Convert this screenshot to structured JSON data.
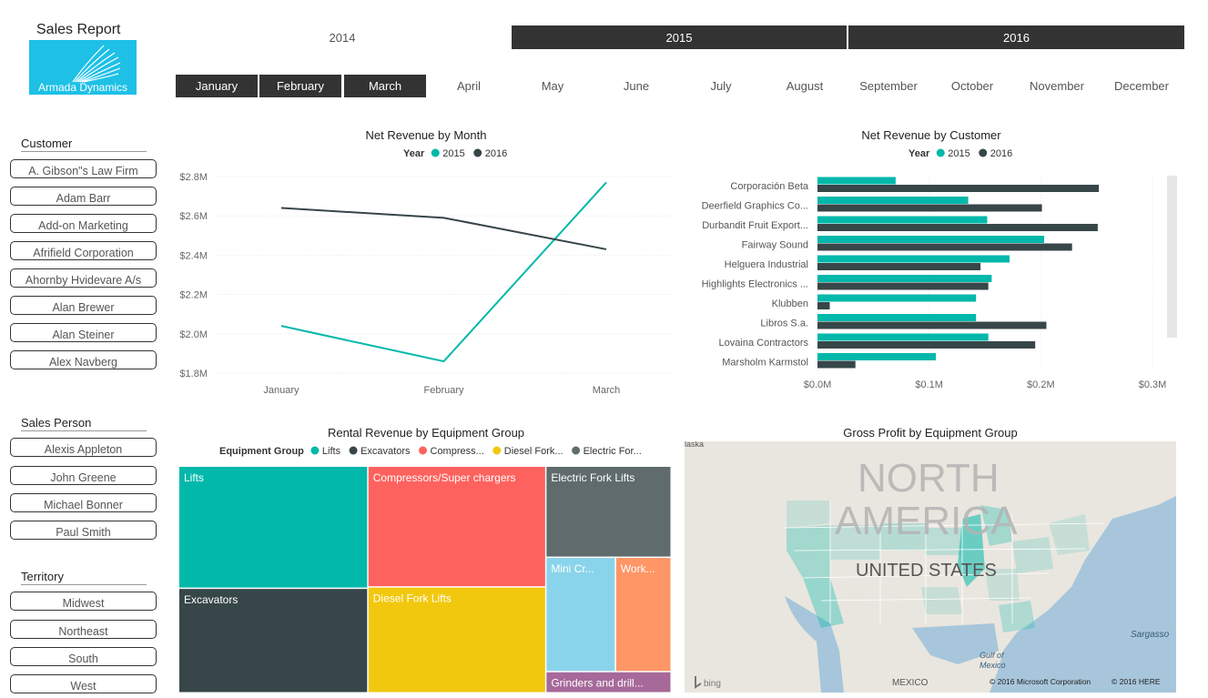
{
  "header": {
    "title": "Sales Report",
    "logo_text": "Armada Dynamics"
  },
  "years": [
    {
      "label": "2014",
      "selected": false
    },
    {
      "label": "2015",
      "selected": true
    },
    {
      "label": "2016",
      "selected": true
    }
  ],
  "months": [
    {
      "label": "January",
      "selected": true
    },
    {
      "label": "February",
      "selected": true
    },
    {
      "label": "March",
      "selected": true
    },
    {
      "label": "April",
      "selected": false
    },
    {
      "label": "May",
      "selected": false
    },
    {
      "label": "June",
      "selected": false
    },
    {
      "label": "July",
      "selected": false
    },
    {
      "label": "August",
      "selected": false
    },
    {
      "label": "September",
      "selected": false
    },
    {
      "label": "October",
      "selected": false
    },
    {
      "label": "November",
      "selected": false
    },
    {
      "label": "December",
      "selected": false
    }
  ],
  "slicers": {
    "customer": {
      "title": "Customer",
      "items": [
        "A. Gibson\"s Law Firm",
        "Adam Barr",
        "Add-on Marketing",
        "Afrifield Corporation",
        "Ahornby Hvidevare A/s",
        "Alan Brewer",
        "Alan Steiner",
        "Alex Navberg"
      ]
    },
    "sales_person": {
      "title": "Sales Person",
      "items": [
        "Alexis Appleton",
        "John Greene",
        "Michael Bonner",
        "Paul Smith"
      ]
    },
    "territory": {
      "title": "Territory",
      "items": [
        "Midwest",
        "Northeast",
        "South",
        "West"
      ]
    }
  },
  "colors": {
    "series_2015": "#01b8aa",
    "series_2016": "#374649",
    "selected": "#333333",
    "logo_bg": "#1ec0e6"
  },
  "chart_data": [
    {
      "type": "line",
      "title": "Net Revenue by Month",
      "legend_title": "Year",
      "legend_position": "top-center",
      "categories": [
        "January",
        "February",
        "March"
      ],
      "y_ticks": [
        "$1.8M",
        "$2.0M",
        "$2.2M",
        "$2.4M",
        "$2.6M",
        "$2.8M"
      ],
      "ylim": [
        1.8,
        2.8
      ],
      "grid": true,
      "series": [
        {
          "name": "2015",
          "color": "#01b8aa",
          "values": [
            2.04,
            1.86,
            2.77
          ]
        },
        {
          "name": "2016",
          "color": "#374649",
          "values": [
            2.64,
            2.59,
            2.43
          ]
        }
      ]
    },
    {
      "type": "bar",
      "orientation": "horizontal",
      "title": "Net Revenue by Customer",
      "legend_title": "Year",
      "legend_position": "top-center",
      "categories": [
        "Corporación Beta",
        "Deerfield Graphics Co...",
        "Durbandit Fruit Export...",
        "Fairway Sound",
        "Helguera Industrial",
        "Highlights Electronics ...",
        "Klubben",
        "Libros S.a.",
        "Lovaina Contractors",
        "Marsholm Karmstol"
      ],
      "x_ticks": [
        "$0.0M",
        "$0.1M",
        "$0.2M",
        "$0.3M"
      ],
      "xlim": [
        0,
        0.3
      ],
      "grid": true,
      "series": [
        {
          "name": "2015",
          "color": "#01b8aa",
          "values": [
            0.07,
            0.135,
            0.152,
            0.203,
            0.172,
            0.156,
            0.142,
            0.142,
            0.153,
            0.106
          ]
        },
        {
          "name": "2016",
          "color": "#374649",
          "values": [
            0.252,
            0.201,
            0.251,
            0.228,
            0.146,
            0.153,
            0.011,
            0.205,
            0.195,
            0.034
          ]
        }
      ]
    },
    {
      "type": "treemap",
      "title": "Rental Revenue by Equipment Group",
      "legend_title": "Equipment Group",
      "legend_position": "top-left",
      "legend": [
        {
          "name": "Lifts",
          "color": "#01b8aa"
        },
        {
          "name": "Excavators",
          "color": "#374649"
        },
        {
          "name": "Compress...",
          "color": "#fd625e"
        },
        {
          "name": "Diesel Fork...",
          "color": "#f2c80f"
        },
        {
          "name": "Electric For...",
          "color": "#5f6b6d"
        }
      ],
      "tiles": [
        {
          "label": "Lifts",
          "color": "#01b8aa",
          "value": 17.4
        },
        {
          "label": "Excavators",
          "color": "#374649",
          "value": 14.9
        },
        {
          "label": "Compressors/Super chargers",
          "color": "#fd625e",
          "value": 16.2
        },
        {
          "label": "Diesel Fork Lifts",
          "color": "#f2c80f",
          "value": 14.2
        },
        {
          "label": "Electric Fork Lifts",
          "color": "#5f6b6d",
          "value": 8.6
        },
        {
          "label": "Mini Cr...",
          "color": "#8ad4eb",
          "value": 6.0
        },
        {
          "label": "Work...",
          "color": "#fe9666",
          "value": 4.8
        },
        {
          "label": "Grinders and drill...",
          "color": "#a66999",
          "value": 2.0
        }
      ]
    }
  ],
  "map": {
    "title": "Gross Profit by Equipment Group",
    "label_continent_1": "NORTH",
    "label_continent_2": "AMERICA",
    "label_country": "UNITED STATES",
    "label_mexico": "MEXICO",
    "label_gulf_1": "Gulf of",
    "label_gulf_2": "Mexico",
    "label_sargasso": "Sargasso",
    "label_top_clip": "laska",
    "bing": "bing",
    "copyright_1": "© 2016 Microsoft Corporation",
    "copyright_2": "© 2016 HERE"
  }
}
